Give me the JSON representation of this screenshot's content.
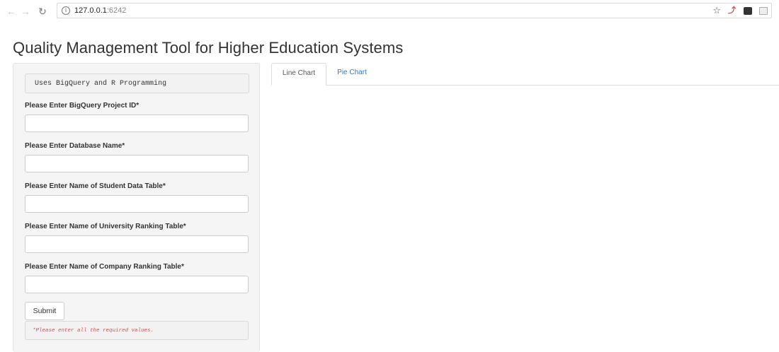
{
  "browser": {
    "url_host": "127.0.0.1",
    "url_port": ":6242",
    "back_icon": "back-arrow-icon",
    "forward_icon": "forward-arrow-icon",
    "reload_icon": "reload-icon",
    "info_icon": "info-icon",
    "bookmark_icon": "star-icon"
  },
  "page": {
    "title": "Quality Management Tool for Higher Education Systems"
  },
  "sidebar": {
    "subtitle": "Uses BigQuery and R Programming",
    "fields": [
      {
        "label": "Please Enter BigQuery Project ID*",
        "value": ""
      },
      {
        "label": "Please Enter Database Name*",
        "value": ""
      },
      {
        "label": "Please Enter Name of Student Data Table*",
        "value": ""
      },
      {
        "label": "Please Enter Name of University Ranking Table*",
        "value": ""
      },
      {
        "label": "Please Enter Name of Company Ranking Table*",
        "value": ""
      }
    ],
    "submit_label": "Submit",
    "error_message": "*Please enter all the required values."
  },
  "tabs": [
    {
      "label": "Line Chart",
      "active": true
    },
    {
      "label": "Pie Chart",
      "active": false
    }
  ],
  "colors": {
    "accent_link": "#337ab7",
    "error": "#e34a4a",
    "panel_bg": "#f5f5f5"
  }
}
